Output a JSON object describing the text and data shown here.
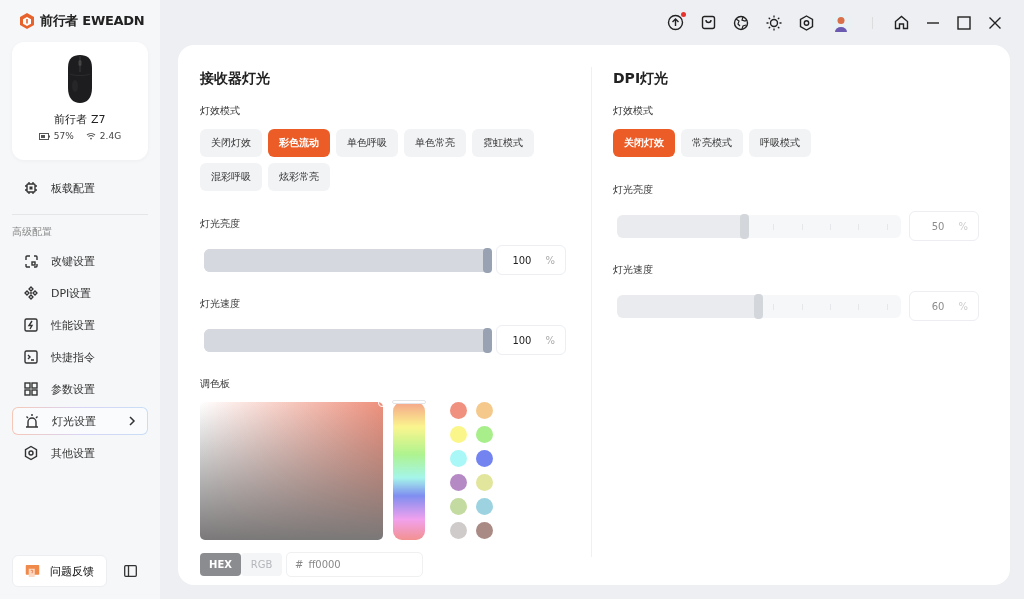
{
  "app": {
    "logo_text": "前行者 EWEADN"
  },
  "toolbar": {
    "update_badge": true
  },
  "device": {
    "name": "前行者 Z7",
    "battery": "57%",
    "connection": "2.4G"
  },
  "sidebar": {
    "top_item": {
      "label": "板载配置"
    },
    "section_label": "高级配置",
    "items": [
      {
        "label": "改键设置",
        "selected": false
      },
      {
        "label": "DPI设置",
        "selected": false
      },
      {
        "label": "性能设置",
        "selected": false
      },
      {
        "label": "快捷指令",
        "selected": false
      },
      {
        "label": "参数设置",
        "selected": false
      },
      {
        "label": "灯光设置",
        "selected": true
      },
      {
        "label": "其他设置",
        "selected": false
      }
    ],
    "feedback": "问题反馈"
  },
  "receiver": {
    "title": "接收器灯光",
    "mode_label": "灯效模式",
    "modes": [
      {
        "label": "关闭灯效",
        "selected": false
      },
      {
        "label": "彩色流动",
        "selected": true
      },
      {
        "label": "单色呼吸",
        "selected": false
      },
      {
        "label": "单色常亮",
        "selected": false
      },
      {
        "label": "霓虹模式",
        "selected": false
      },
      {
        "label": "混彩呼吸",
        "selected": false
      },
      {
        "label": "炫彩常亮",
        "selected": false
      }
    ],
    "sliders": [
      {
        "label": "灯光亮度",
        "level": 1,
        "value": "100",
        "unit": "%",
        "disabled": false
      },
      {
        "label": "灯光速度",
        "level": 1,
        "value": "100",
        "unit": "%",
        "disabled": false
      }
    ],
    "palette": {
      "label": "调色板",
      "swatches": [
        {
          "color": "#f0907e"
        },
        {
          "color": "#f5c98c"
        },
        {
          "color": "#fbf68a"
        },
        {
          "color": "#a8ef8c"
        },
        {
          "color": "#a9f7f6"
        },
        {
          "color": "#7384f1"
        },
        {
          "color": "#b58ac4"
        },
        {
          "color": "#e2e59c"
        },
        {
          "color": "#c3dba0"
        },
        {
          "color": "#9dd3e1"
        },
        {
          "color": "#d0cbcb"
        },
        {
          "color": "#a98a84"
        }
      ],
      "formats": [
        {
          "label": "HEX",
          "selected": true
        },
        {
          "label": "RGB",
          "selected": false
        }
      ],
      "hue": {
        "level": 0
      },
      "hex_prefix": "#",
      "hex_value": "ff0000"
    }
  },
  "dpi": {
    "title": "DPI灯光",
    "mode_label": "灯效模式",
    "modes": [
      {
        "label": "关闭灯效",
        "selected": true
      },
      {
        "label": "常亮模式",
        "selected": false
      },
      {
        "label": "呼吸模式",
        "selected": false
      }
    ],
    "sliders": [
      {
        "label": "灯光亮度",
        "level": 0.45,
        "value": "50",
        "unit": "%",
        "disabled": true
      },
      {
        "label": "灯光速度",
        "level": 0.5,
        "value": "60",
        "unit": "%",
        "disabled": true
      }
    ]
  }
}
